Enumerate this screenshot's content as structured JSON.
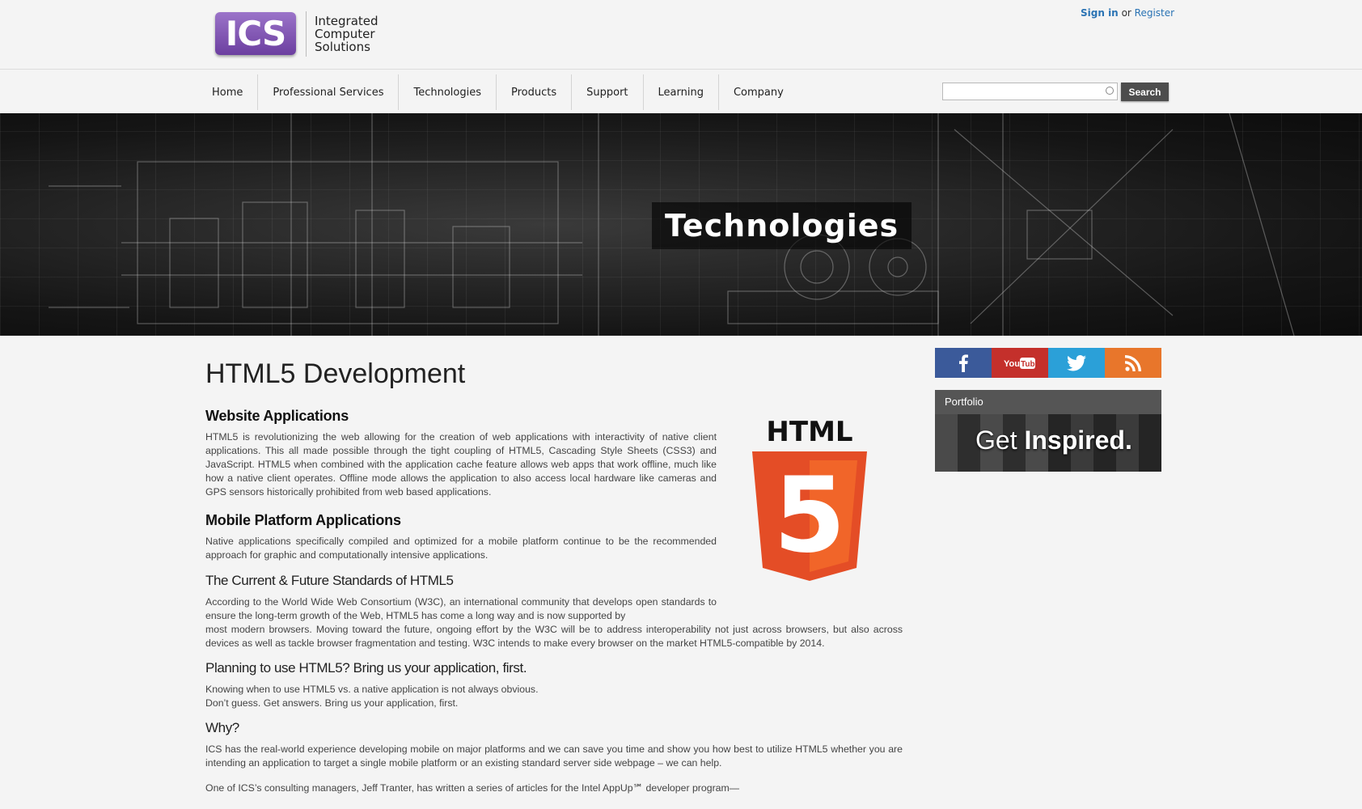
{
  "header": {
    "logo_mark": "ICS",
    "logo_lines": [
      "Integrated",
      "Computer",
      "Solutions"
    ],
    "sign_in": "Sign in",
    "or": "or",
    "register": "Register"
  },
  "nav": {
    "items": [
      "Home",
      "Professional Services",
      "Technologies",
      "Products",
      "Support",
      "Learning",
      "Company"
    ],
    "search_placeholder": "",
    "search_button": "Search"
  },
  "banner": {
    "title": "Technologies"
  },
  "main": {
    "title": "HTML5 Development",
    "sections": [
      {
        "heading": "Website Applications",
        "body": "HTML5 is revolutionizing the web allowing for the creation of web applications with interactivity of native client applications. This all made possible through the tight coupling of HTML5, Cascading Style Sheets (CSS3) and JavaScript. HTML5 when combined with the application cache feature allows web apps that work offline, much like how a native client operates. Offline mode allows the application to also access local hardware like cameras and GPS sensors historically prohibited from web based applications."
      },
      {
        "heading": "Mobile Platform Applications",
        "body": "Native applications specifically compiled and optimized for a mobile platform continue to be the recommended approach for graphic and computationally intensive applications."
      },
      {
        "heading": "The Current & Future Standards of HTML5",
        "body_line1": "According to the World Wide Web Consortium (W3C), an international community that develops open standards to ensure the long-term growth of the Web, HTML5 has come a long way and is now supported by",
        "body_line2": "most modern browsers. Moving toward the future, ongoing effort by the W3C will be to address interoperability not just across browsers, but also across devices as well as tackle browser fragmentation and testing. W3C intends to make every browser on the market HTML5-compatible by 2014."
      },
      {
        "heading": "Planning to use HTML5? Bring us your application, first.",
        "line1": "Knowing when to use HTML5 vs. a native application is not always obvious.",
        "line2": "Don’t guess. Get answers. Bring us your application, first."
      },
      {
        "heading": "Why?",
        "body": "ICS has the real-world experience developing mobile on major platforms and we can save you time and show you how best to utilize HTML5 whether you are intending an application to target  a single mobile platform or an existing standard server side webpage – we can help."
      }
    ],
    "footer_line": "One of ICS’s consulting managers, Jeff Tranter, has written a series of articles for the Intel AppUp℠ developer program—",
    "html5_logo_text": "HTML",
    "html5_logo_number": "5"
  },
  "sidebar": {
    "social": [
      {
        "name": "facebook",
        "glyph": "f",
        "color": "#3b5a9a"
      },
      {
        "name": "youtube",
        "glyph": "You Tube",
        "color": "#c4302b"
      },
      {
        "name": "twitter",
        "glyph": "twitter",
        "color": "#2ba0d8"
      },
      {
        "name": "rss",
        "glyph": "rss",
        "color": "#e8762b"
      }
    ],
    "portfolio_label": "Portfolio",
    "portfolio_tag_light": "Get",
    "portfolio_tag_bold": "Inspired."
  }
}
